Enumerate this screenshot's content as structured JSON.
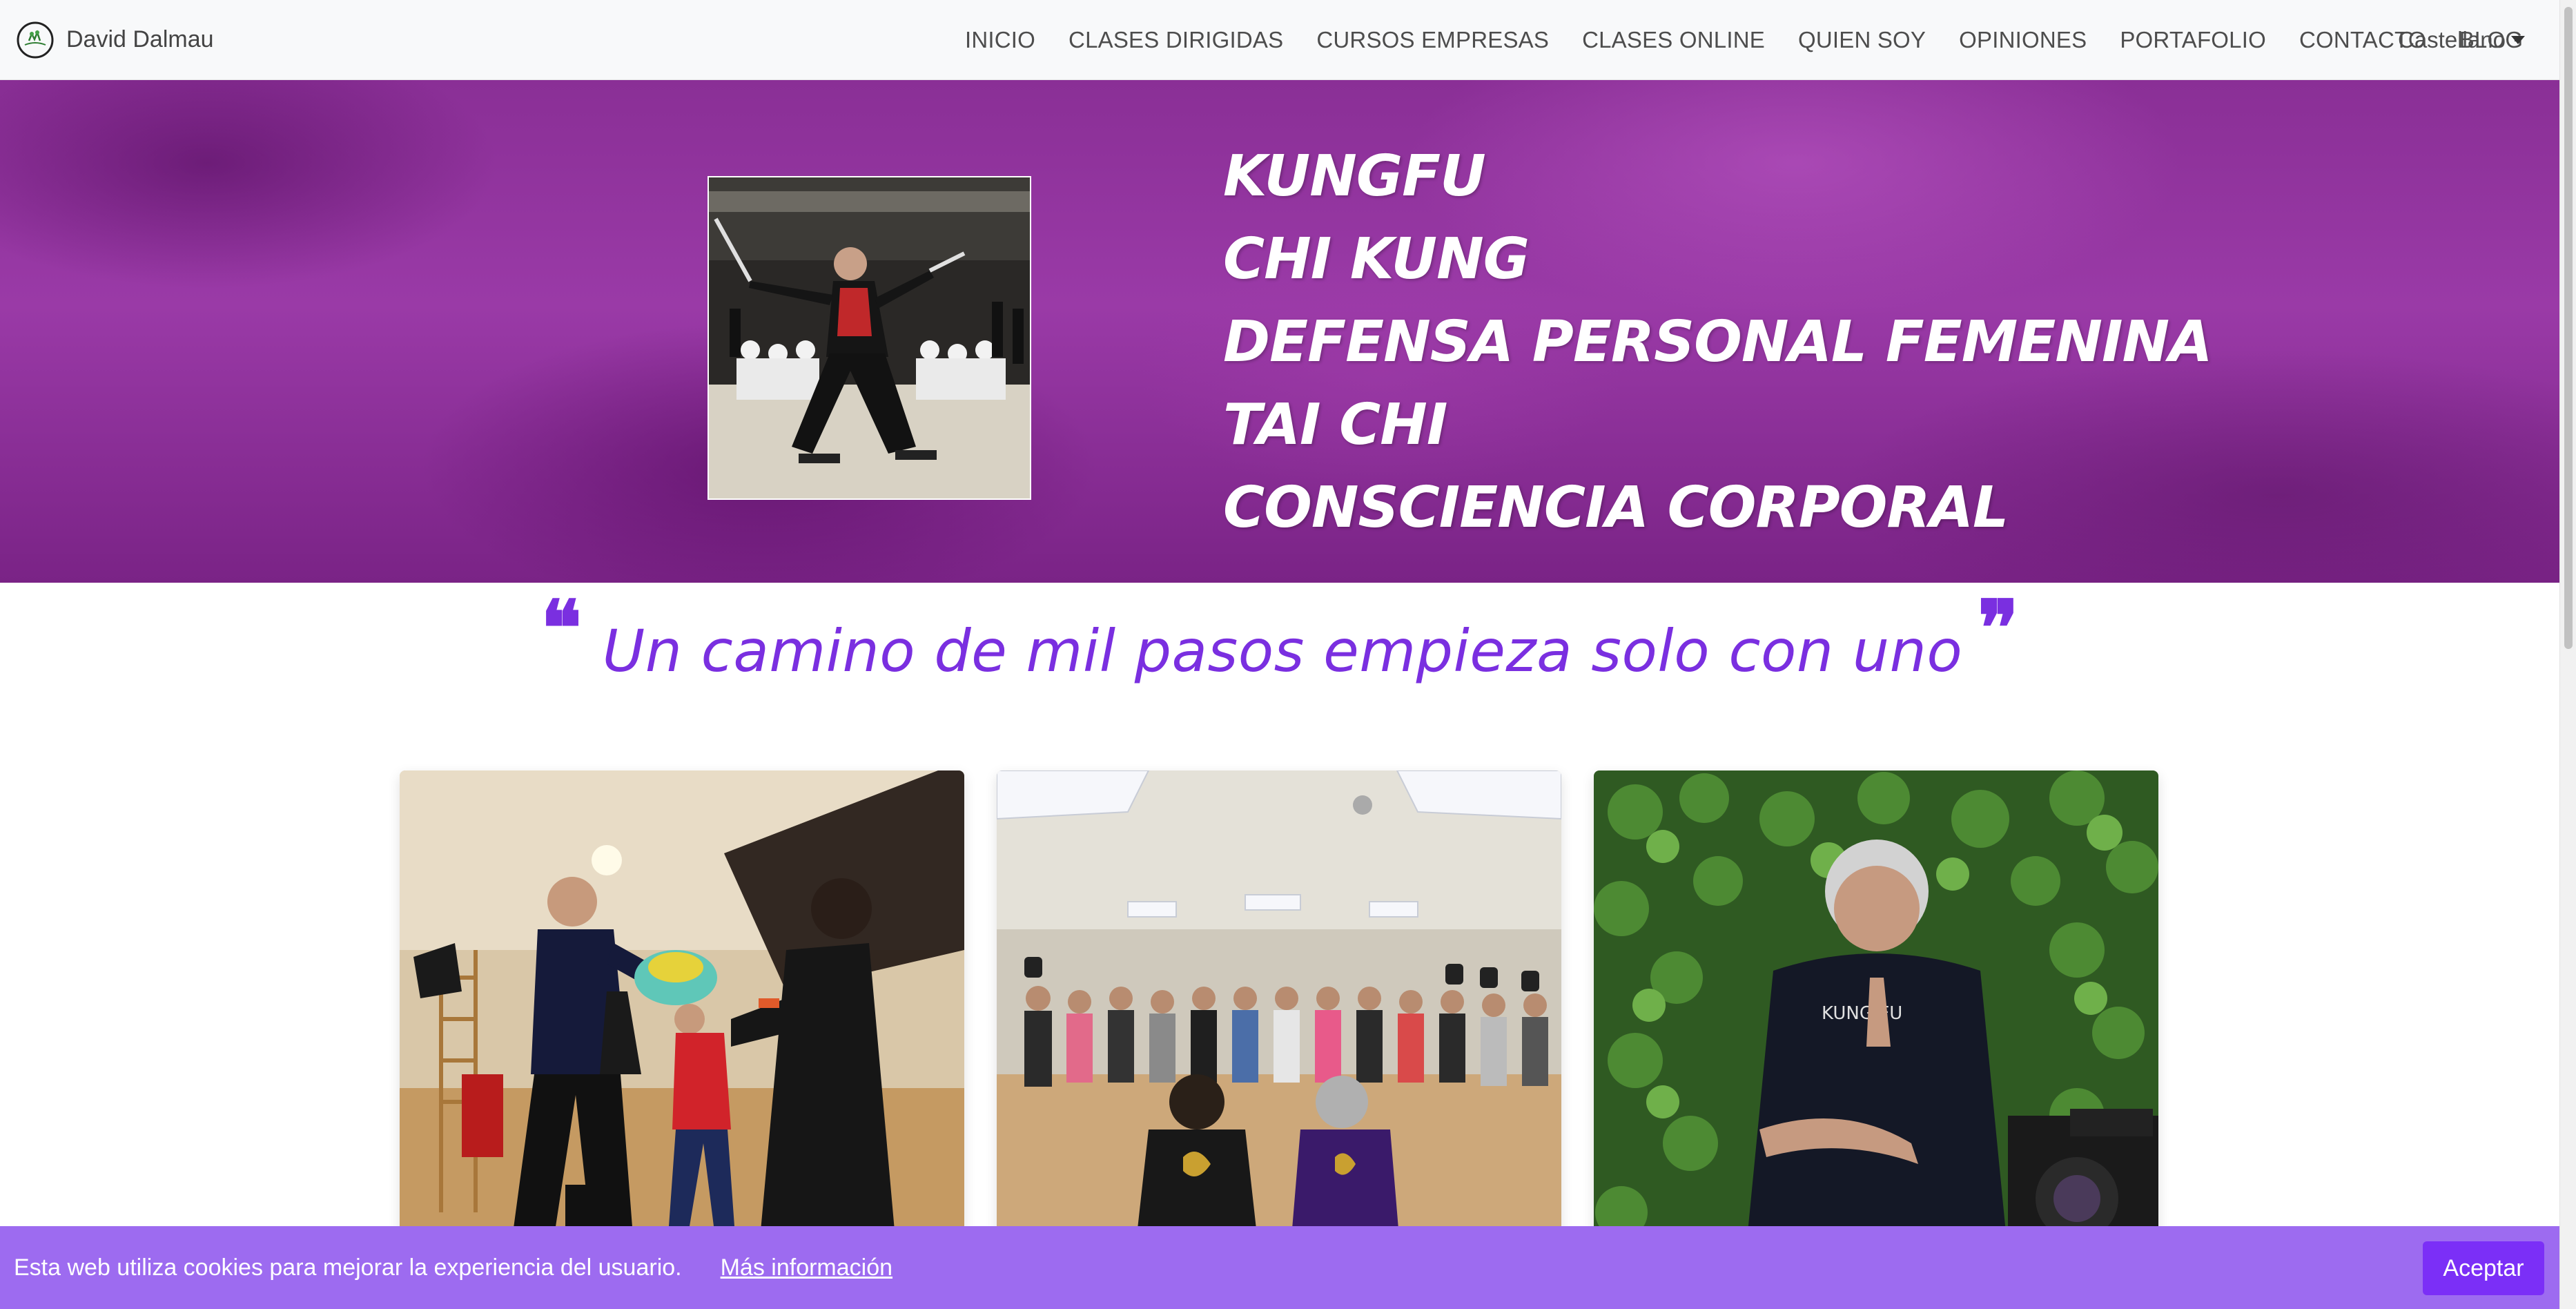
{
  "brand": {
    "name": "David Dalmau",
    "logo_icon": "tree-circle-logo-icon"
  },
  "nav": {
    "items": [
      {
        "label": "INICIO"
      },
      {
        "label": "CLASES DIRIGIDAS"
      },
      {
        "label": "CURSOS EMPRESAS"
      },
      {
        "label": "CLASES ONLINE"
      },
      {
        "label": "QUIEN SOY"
      },
      {
        "label": "OPINIONES"
      },
      {
        "label": "PORTAFOLIO"
      },
      {
        "label": "CONTACTO"
      },
      {
        "label": "BLOG"
      }
    ],
    "language": "Castellano"
  },
  "hero": {
    "items": [
      "KUNGFU",
      "CHI KUNG",
      "DEFENSA PERSONAL FEMENINA",
      "TAI CHI",
      "CONSCIENCIA CORPORAL"
    ],
    "background_color": "#8a2f96"
  },
  "quote": {
    "open_mark": "❝",
    "close_mark": "❞",
    "text": "Un camino de mil pasos empieza solo con uno",
    "color": "#7a2fe0"
  },
  "cookie": {
    "text": "Esta web utiliza cookies para mejorar la experiencia del usuario.",
    "link": "Más información",
    "accept": "Aceptar",
    "background_color": "#9d6bf0",
    "button_color": "#7b2ff7"
  }
}
